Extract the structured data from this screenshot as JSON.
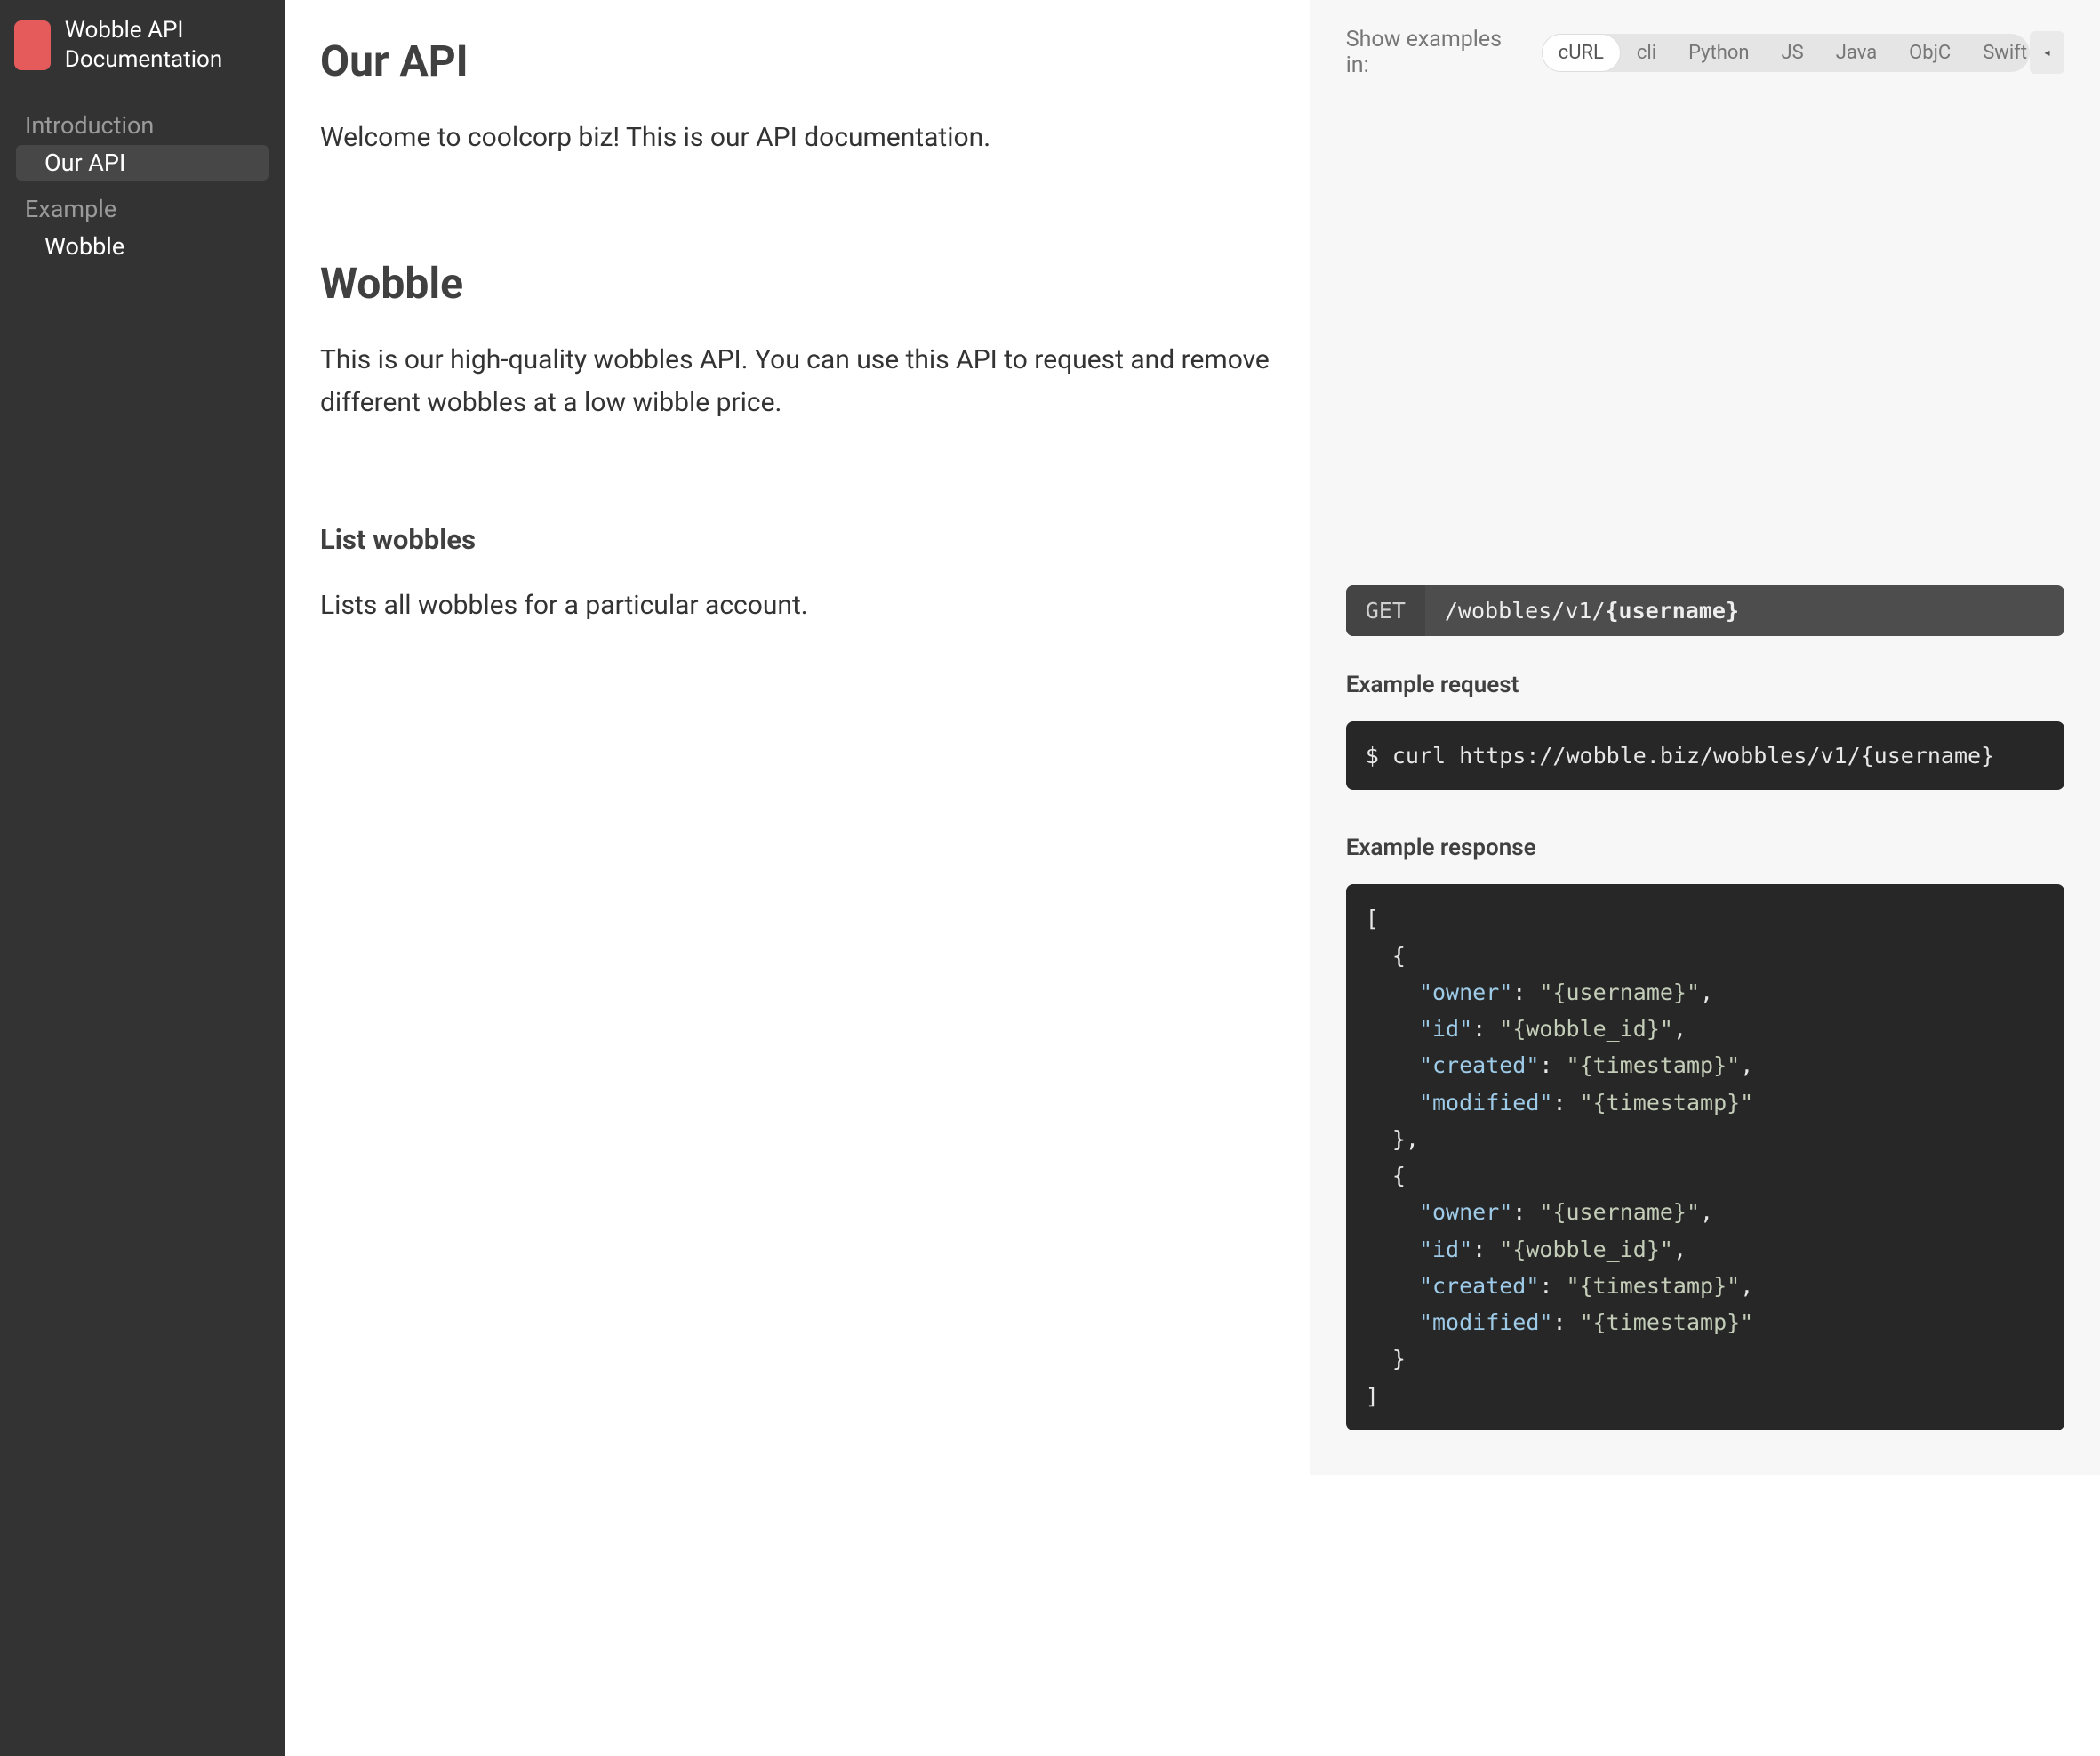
{
  "sidebar": {
    "title": "Wobble API Documentation",
    "groups": [
      {
        "header": "Introduction",
        "items": [
          {
            "label": "Our API",
            "active": true
          }
        ]
      },
      {
        "header": "Example",
        "items": [
          {
            "label": "Wobble",
            "active": false
          }
        ]
      }
    ]
  },
  "lang": {
    "label": "Show examples in:",
    "active": "cURL",
    "options": [
      "cURL",
      "cli",
      "Python",
      "JS",
      "Java",
      "ObjC",
      "Swift"
    ]
  },
  "sections": {
    "api": {
      "title": "Our API",
      "body": "Welcome to coolcorp biz! This is our API documentation."
    },
    "wobble": {
      "title": "Wobble",
      "body": "This is our high-quality wobbles API. You can use this API to request and remove different wobbles at a low wibble price."
    },
    "list": {
      "title": "List wobbles",
      "body": "Lists all wobbles for a particular account.",
      "method": "GET",
      "path_prefix": "/wobbles/v1/",
      "path_param": "{username}",
      "req_heading": "Example request",
      "request": "$ curl https://wobble.biz/wobbles/v1/{username}",
      "res_heading": "Example response",
      "response": [
        {
          "owner": "{username}",
          "id": "{wobble_id}",
          "created": "{timestamp}",
          "modified": "{timestamp}"
        },
        {
          "owner": "{username}",
          "id": "{wobble_id}",
          "created": "{timestamp}",
          "modified": "{timestamp}"
        }
      ]
    }
  }
}
